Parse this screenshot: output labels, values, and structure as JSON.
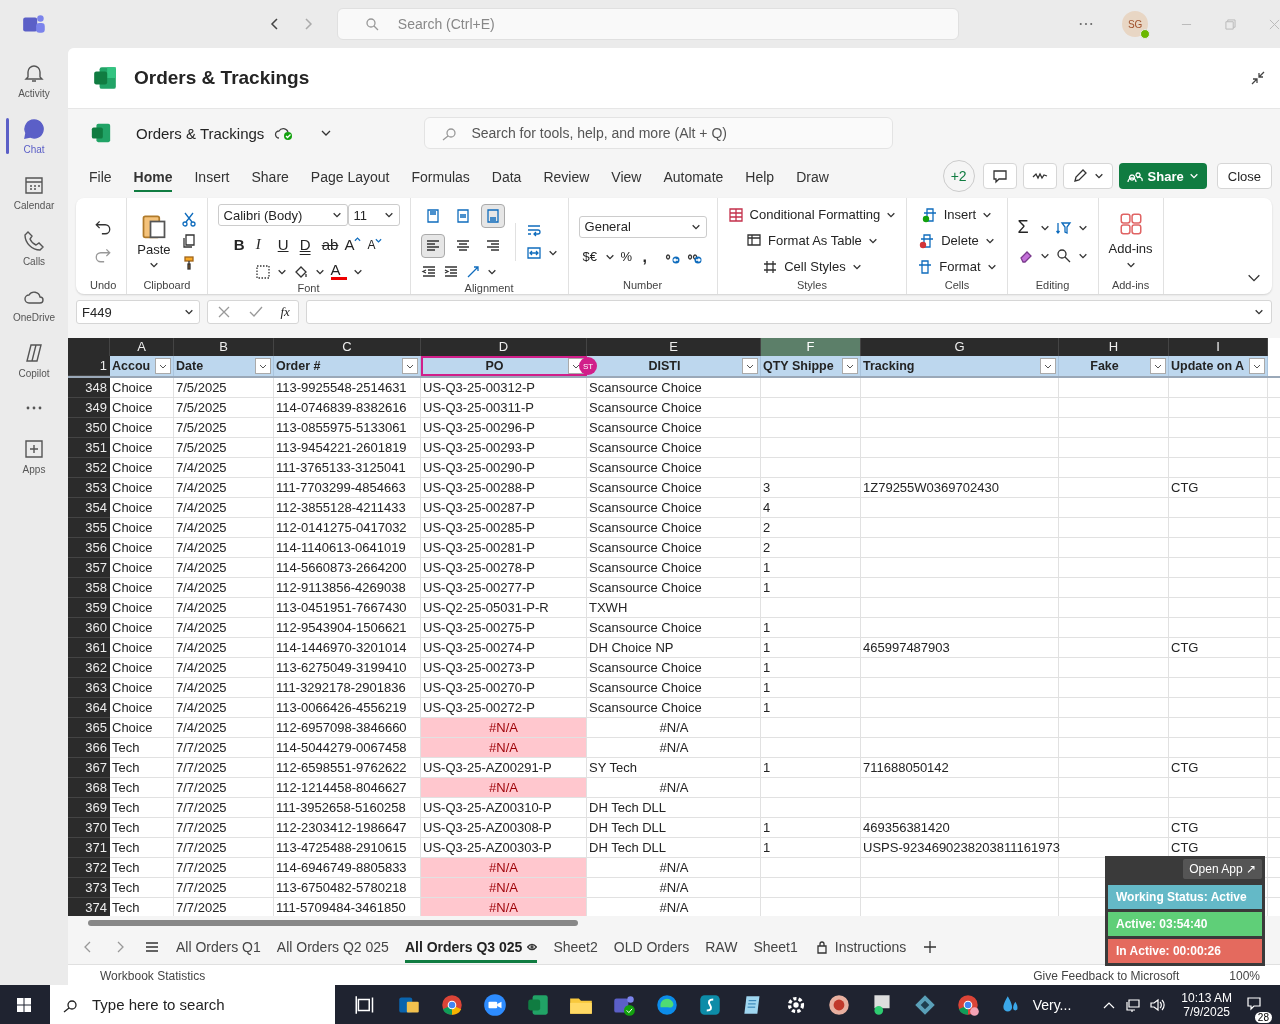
{
  "teams": {
    "search": {
      "placeholder": "Search (Ctrl+E)"
    },
    "avatar": "SG"
  },
  "rail": {
    "items": [
      {
        "label": "Activity",
        "selected": false
      },
      {
        "label": "Chat",
        "selected": true
      },
      {
        "label": "Calendar",
        "selected": false
      },
      {
        "label": "Calls",
        "selected": false
      },
      {
        "label": "OneDrive",
        "selected": false
      },
      {
        "label": "Copilot",
        "selected": false
      }
    ],
    "apps": {
      "label": "Apps",
      "selected": false
    }
  },
  "app_title": "Orders & Trackings",
  "workbook": {
    "name": "Orders & Trackings",
    "search": {
      "placeholder": "Search for tools, help, and more (Alt + Q)"
    }
  },
  "menu": [
    {
      "label": "File",
      "selected": false
    },
    {
      "label": "Home",
      "selected": true
    },
    {
      "label": "Insert",
      "selected": false
    },
    {
      "label": "Share",
      "selected": false
    },
    {
      "label": "Page Layout",
      "selected": false
    },
    {
      "label": "Formulas",
      "selected": false
    },
    {
      "label": "Data",
      "selected": false
    },
    {
      "label": "Review",
      "selected": false
    },
    {
      "label": "View",
      "selected": false
    },
    {
      "label": "Automate",
      "selected": false
    },
    {
      "label": "Help",
      "selected": false
    },
    {
      "label": "Draw",
      "selected": false
    }
  ],
  "coauthors": "+2",
  "share": "Share",
  "close": "Close",
  "ribbon": {
    "groups": [
      "Undo",
      "Clipboard",
      "Font",
      "Alignment",
      "Number",
      "Styles",
      "Cells",
      "Editing",
      "Add-ins"
    ],
    "redo_disabled": true,
    "paste": "Paste",
    "font": {
      "family": "Calibri (Body)",
      "size": "11",
      "toggles": [
        "B",
        "I",
        "U",
        "D",
        "ab"
      ],
      "grow": "A",
      "shrink": "A",
      "color_letter": "A"
    },
    "vertical_align": [
      {
        "selected": false
      },
      {
        "selected": false
      },
      {
        "selected": true
      }
    ],
    "horizontal_align": [
      {
        "selected": true
      },
      {
        "selected": false
      },
      {
        "selected": false
      }
    ],
    "number": {
      "format": "General",
      "currency": "$€",
      "percent": "%",
      "comma": ","
    },
    "styles": [
      "Conditional Formatting",
      "Format As Table",
      "Cell Styles"
    ],
    "cells": [
      "Insert",
      "Delete",
      "Format"
    ],
    "sum": "Σ",
    "addins": "Add-ins"
  },
  "formula_bar": {
    "name_box": "F449",
    "fx": "fx"
  },
  "columns": [
    {
      "letter": "A",
      "header": "Accou",
      "centered": false,
      "selected": false
    },
    {
      "letter": "B",
      "header": "Date",
      "centered": false,
      "selected": false
    },
    {
      "letter": "C",
      "header": "Order #",
      "centered": false,
      "selected": false
    },
    {
      "letter": "D",
      "header": "PO",
      "centered": true,
      "selected": false,
      "presence": "ST"
    },
    {
      "letter": "E",
      "header": "DISTI",
      "centered": true,
      "selected": false
    },
    {
      "letter": "F",
      "header": "QTY Shippe",
      "centered": false,
      "selected": true
    },
    {
      "letter": "G",
      "header": "Tracking",
      "centered": false,
      "selected": false
    },
    {
      "letter": "H",
      "header": "Fake",
      "centered": true,
      "selected": false
    },
    {
      "letter": "I",
      "header": "Update on A",
      "centered": false,
      "selected": false
    }
  ],
  "header_row": "1",
  "rows": [
    {
      "n": "348",
      "account": "Choice",
      "date": "7/5/2025",
      "order": "113-9925548-2514631",
      "po": "US-Q3-25-00312-P",
      "disti": "Scansource Choice",
      "missing": false
    },
    {
      "n": "349",
      "account": "Choice",
      "date": "7/5/2025",
      "order": "114-0746839-8382616",
      "po": "US-Q3-25-00311-P",
      "disti": "Scansource Choice",
      "missing": false
    },
    {
      "n": "350",
      "account": "Choice",
      "date": "7/5/2025",
      "order": "113-0855975-5133061",
      "po": "US-Q3-25-00296-P",
      "disti": "Scansource Choice",
      "missing": false
    },
    {
      "n": "351",
      "account": "Choice",
      "date": "7/5/2025",
      "order": "113-9454221-2601819",
      "po": "US-Q3-25-00293-P",
      "disti": "Scansource Choice",
      "missing": false
    },
    {
      "n": "352",
      "account": "Choice",
      "date": "7/4/2025",
      "order": "111-3765133-3125041",
      "po": "US-Q3-25-00290-P",
      "disti": "Scansource Choice",
      "missing": false
    },
    {
      "n": "353",
      "account": "Choice",
      "date": "7/4/2025",
      "order": "111-7703299-4854663",
      "po": "US-Q3-25-00288-P",
      "disti": "Scansource Choice",
      "qty": "3",
      "tracking": "1Z79255W0369702430",
      "update": "CTG",
      "missing": false
    },
    {
      "n": "354",
      "account": "Choice",
      "date": "7/4/2025",
      "order": "112-3855128-4211433",
      "po": "US-Q3-25-00287-P",
      "disti": "Scansource Choice",
      "qty": "4",
      "missing": false
    },
    {
      "n": "355",
      "account": "Choice",
      "date": "7/4/2025",
      "order": "112-0141275-0417032",
      "po": "US-Q3-25-00285-P",
      "disti": "Scansource Choice",
      "qty": "2",
      "missing": false
    },
    {
      "n": "356",
      "account": "Choice",
      "date": "7/4/2025",
      "order": "114-1140613-0641019",
      "po": "US-Q3-25-00281-P",
      "disti": "Scansource Choice",
      "qty": "2",
      "missing": false
    },
    {
      "n": "357",
      "account": "Choice",
      "date": "7/4/2025",
      "order": "114-5660873-2664200",
      "po": "US-Q3-25-00278-P",
      "disti": "Scansource Choice",
      "qty": "1",
      "missing": false
    },
    {
      "n": "358",
      "account": "Choice",
      "date": "7/4/2025",
      "order": "112-9113856-4269038",
      "po": "US-Q3-25-00277-P",
      "disti": "Scansource Choice",
      "qty": "1",
      "missing": false
    },
    {
      "n": "359",
      "account": "Choice",
      "date": "7/4/2025",
      "order": "113-0451951-7667430",
      "po": "US-Q2-25-05031-P-R",
      "disti": "TXWH",
      "missing": false
    },
    {
      "n": "360",
      "account": "Choice",
      "date": "7/4/2025",
      "order": "112-9543904-1506621",
      "po": "US-Q3-25-00275-P",
      "disti": "Scansource Choice",
      "qty": "1",
      "missing": false
    },
    {
      "n": "361",
      "account": "Choice",
      "date": "7/4/2025",
      "order": "114-1446970-3201014",
      "po": "US-Q3-25-00274-P",
      "disti": "DH Choice NP",
      "qty": "1",
      "tracking": "465997487903",
      "update": "CTG",
      "missing": false
    },
    {
      "n": "362",
      "account": "Choice",
      "date": "7/4/2025",
      "order": "113-6275049-3199410",
      "po": "US-Q3-25-00273-P",
      "disti": "Scansource Choice",
      "qty": "1",
      "missing": false
    },
    {
      "n": "363",
      "account": "Choice",
      "date": "7/4/2025",
      "order": "111-3292178-2901836",
      "po": "US-Q3-25-00270-P",
      "disti": "Scansource Choice",
      "qty": "1",
      "missing": false
    },
    {
      "n": "364",
      "account": "Choice",
      "date": "7/4/2025",
      "order": "113-0066426-4556219",
      "po": "US-Q3-25-00272-P",
      "disti": "Scansource Choice",
      "qty": "1",
      "missing": false
    },
    {
      "n": "365",
      "account": "Choice",
      "date": "7/4/2025",
      "order": "112-6957098-3846660",
      "po": "#N/A",
      "disti": "#N/A",
      "missing": true
    },
    {
      "n": "366",
      "account": "Tech",
      "date": "7/7/2025",
      "order": "114-5044279-0067458",
      "po": "#N/A",
      "disti": "#N/A",
      "missing": true
    },
    {
      "n": "367",
      "account": "Tech",
      "date": "7/7/2025",
      "order": "112-6598551-9762622",
      "po": "US-Q3-25-AZ00291-P",
      "disti": "SY Tech",
      "qty": "1",
      "tracking": "711688050142",
      "update": "CTG",
      "missing": false
    },
    {
      "n": "368",
      "account": "Tech",
      "date": "7/7/2025",
      "order": "112-1214458-8046627",
      "po": "#N/A",
      "disti": "#N/A",
      "missing": true
    },
    {
      "n": "369",
      "account": "Tech",
      "date": "7/7/2025",
      "order": "111-3952658-5160258",
      "po": "US-Q3-25-AZ00310-P",
      "disti": "DH Tech DLL",
      "missing": false
    },
    {
      "n": "370",
      "account": "Tech",
      "date": "7/7/2025",
      "order": "112-2303412-1986647",
      "po": "US-Q3-25-AZ00308-P",
      "disti": "DH Tech DLL",
      "qty": "1",
      "tracking": "469356381420",
      "update": "CTG",
      "missing": false
    },
    {
      "n": "371",
      "account": "Tech",
      "date": "7/7/2025",
      "order": "113-4725488-2910615",
      "po": "US-Q3-25-AZ00303-P",
      "disti": "DH Tech DLL",
      "qty": "1",
      "tracking": "USPS-9234690238203811161973",
      "update": "CTG",
      "missing": false
    },
    {
      "n": "372",
      "account": "Tech",
      "date": "7/7/2025",
      "order": "114-6946749-8805833",
      "po": "#N/A",
      "disti": "#N/A",
      "missing": true
    },
    {
      "n": "373",
      "account": "Tech",
      "date": "7/7/2025",
      "order": "113-6750482-5780218",
      "po": "#N/A",
      "disti": "#N/A",
      "missing": true
    },
    {
      "n": "374",
      "account": "Tech",
      "date": "7/7/2025",
      "order": "111-5709484-3461850",
      "po": "#N/A",
      "disti": "#N/A",
      "missing": true
    }
  ],
  "sheet_tabs": [
    {
      "label": "All Orders Q1",
      "selected": false,
      "locked": false
    },
    {
      "label": "All Orders Q2 025",
      "selected": false,
      "locked": false
    },
    {
      "label": "All Orders Q3 025",
      "selected": true,
      "locked": false
    },
    {
      "label": "Sheet2",
      "selected": false,
      "locked": false
    },
    {
      "label": "OLD Orders",
      "selected": false,
      "locked": false
    },
    {
      "label": "RAW",
      "selected": false,
      "locked": false
    },
    {
      "label": "Sheet1",
      "selected": false,
      "locked": false
    },
    {
      "label": "Instructions",
      "selected": false,
      "locked": true
    }
  ],
  "status_bar": {
    "left": "Workbook Statistics",
    "feedback": "Give Feedback to Microsoft",
    "zoom": "100%"
  },
  "tracker": {
    "open": "Open App ↗",
    "status": "Working Status: Active",
    "active": "Active: 03:54:40",
    "inactive": "In Active: 00:00:26"
  },
  "taskbar": {
    "search": {
      "placeholder": "Type here to search"
    },
    "weather": "Very...",
    "time": "10:13 AM",
    "date": "7/9/2025",
    "notifications": "28"
  }
}
